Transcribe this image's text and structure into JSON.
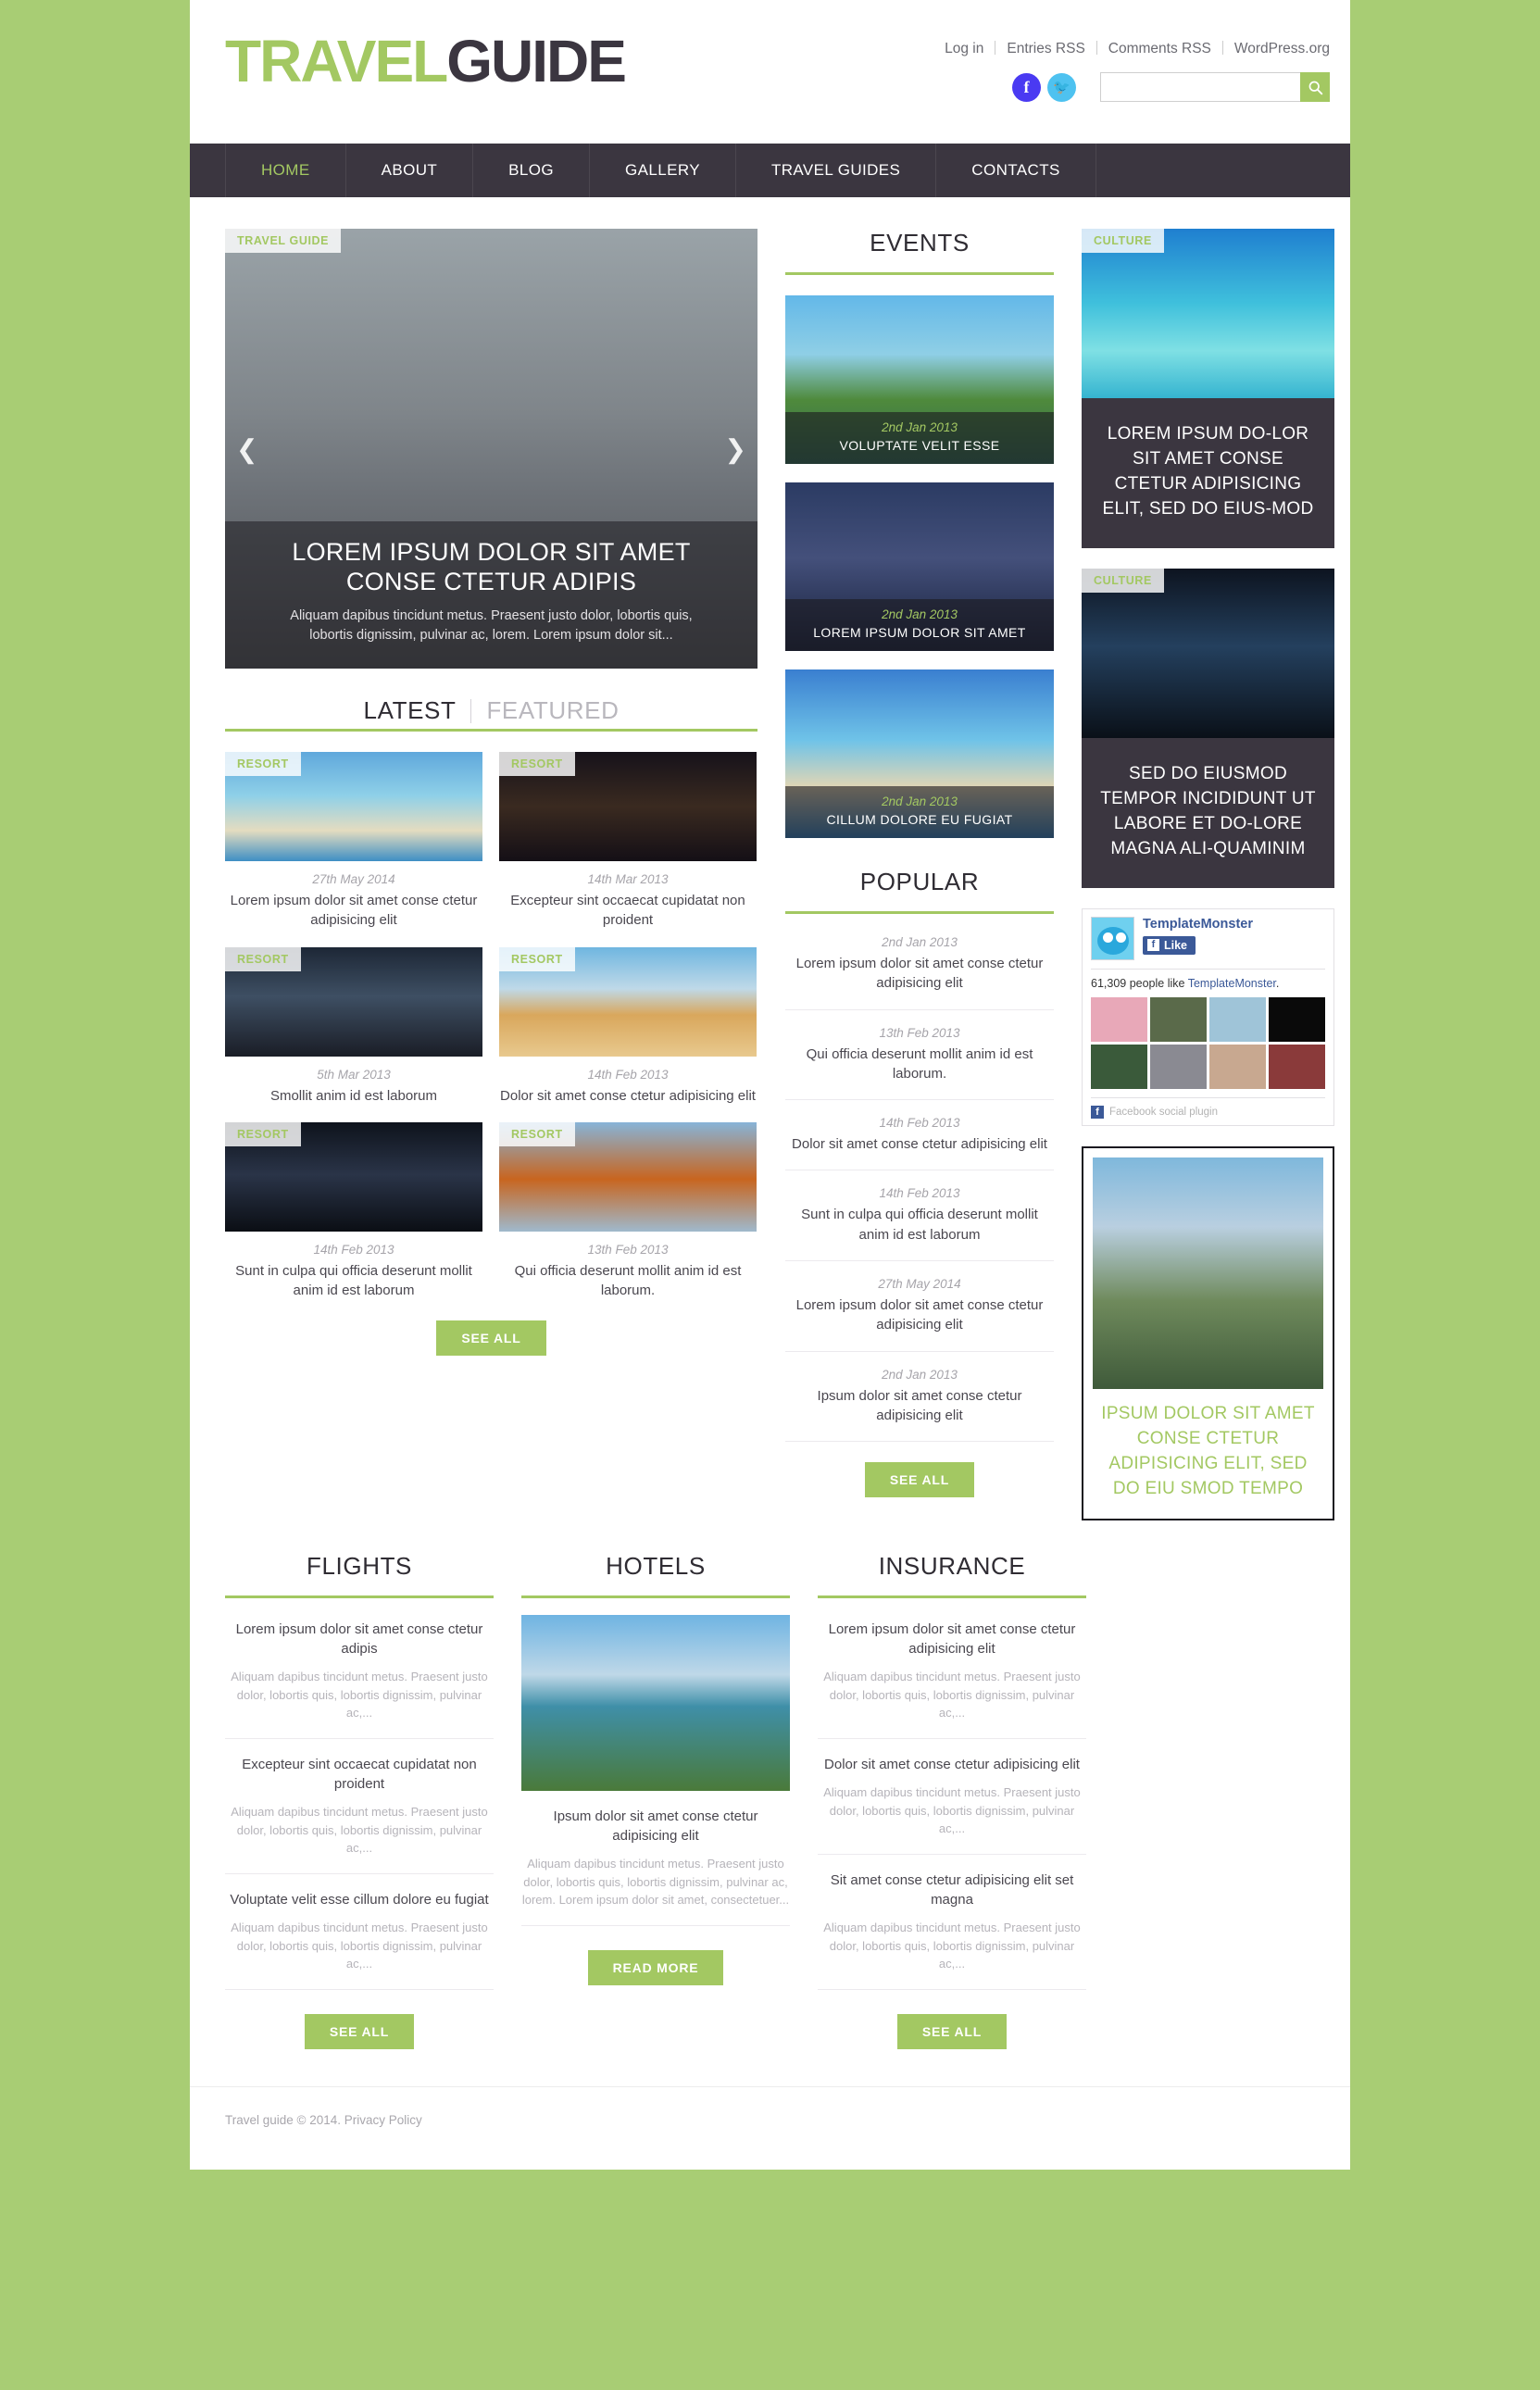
{
  "header": {
    "logo_part1": "TRAVEL",
    "logo_part2": "GUIDE",
    "toplinks": [
      "Log in",
      "Entries RSS",
      "Comments RSS",
      "WordPress.org"
    ],
    "social": [
      "facebook-icon",
      "twitter-icon"
    ],
    "search_placeholder": "",
    "search_value": "",
    "search_icon": "search-icon"
  },
  "nav": {
    "items": [
      {
        "label": "HOME",
        "active": true
      },
      {
        "label": "ABOUT",
        "active": false
      },
      {
        "label": "BLOG",
        "active": false
      },
      {
        "label": "GALLERY",
        "active": false
      },
      {
        "label": "TRAVEL GUIDES",
        "active": false
      },
      {
        "label": "CONTACTS",
        "active": false
      }
    ]
  },
  "slider": {
    "badge": "TRAVEL GUIDE",
    "title": "LOREM IPSUM DOLOR SIT AMET CONSE CTETUR ADIPIS",
    "description": "Aliquam dapibus tincidunt metus. Praesent justo dolor, lobortis quis, lobortis dignissim, pulvinar ac, lorem. Lorem ipsum dolor sit...",
    "prev_icon": "chevron-left-icon",
    "next_icon": "chevron-right-icon"
  },
  "posts_section": {
    "tab_latest": "LATEST",
    "tab_featured": "FEATURED",
    "see_all": "SEE ALL",
    "items": [
      {
        "badge": "RESORT",
        "date": "27th May 2014",
        "title": "Lorem ipsum dolor sit amet conse ctetur adipisicing elit",
        "img": "ph-beachpalm"
      },
      {
        "badge": "RESORT",
        "date": "14th Mar 2013",
        "title": "Excepteur sint occaecat cupidatat non proident",
        "img": "ph-bridge"
      },
      {
        "badge": "RESORT",
        "date": "5th Mar 2013",
        "title": "Smollit anim id est laborum",
        "img": "ph-statue"
      },
      {
        "badge": "RESORT",
        "date": "14th Feb 2013",
        "title": "Dolor sit amet conse ctetur adipisicing elit",
        "img": "ph-pyramid"
      },
      {
        "badge": "RESORT",
        "date": "14th Feb 2013",
        "title": "Sunt in culpa qui officia deserunt mollit anim id est laborum",
        "img": "ph-skyline"
      },
      {
        "badge": "RESORT",
        "date": "13th Feb 2013",
        "title": "Qui officia deserunt mollit anim id est laborum.",
        "img": "ph-kremlin"
      }
    ]
  },
  "events": {
    "title": "EVENTS",
    "items": [
      {
        "date": "2nd Jan 2013",
        "title": "VOLUPTATE VELIT ESSE",
        "img": "ph-temple"
      },
      {
        "date": "2nd Jan 2013",
        "title": "LOREM IPSUM DOLOR SIT AMET",
        "img": "ph-city"
      },
      {
        "date": "2nd Jan 2013",
        "title": "CILLUM DOLORE EU FUGIAT",
        "img": "ph-beach2"
      }
    ]
  },
  "popular": {
    "title": "POPULAR",
    "see_all": "SEE ALL",
    "items": [
      {
        "date": "2nd Jan 2013",
        "title": "Lorem ipsum dolor sit amet conse ctetur adipisicing elit"
      },
      {
        "date": "13th Feb 2013",
        "title": "Qui officia deserunt mollit anim id est laborum."
      },
      {
        "date": "14th Feb 2013",
        "title": "Dolor sit amet conse ctetur adipisicing elit"
      },
      {
        "date": "14th Feb 2013",
        "title": "Sunt in culpa qui officia deserunt mollit anim id est laborum"
      },
      {
        "date": "27th May 2014",
        "title": "Lorem ipsum dolor sit amet conse ctetur adipisicing elit"
      },
      {
        "date": "2nd Jan 2013",
        "title": "Ipsum dolor sit amet conse ctetur adipisicing elit"
      }
    ]
  },
  "culture_cards": [
    {
      "badge": "CULTURE",
      "title": "LOREM IPSUM DO-LOR SIT AMET CONSE CTETUR ADIPISICING ELIT, SED DO EIUS-MOD",
      "img": "ph-overwater"
    },
    {
      "badge": "CULTURE",
      "title": "SED DO EIUSMOD TEMPOR INCIDIDUNT UT LABORE ET DO-LORE MAGNA ALI-QUAMINIM",
      "img": "ph-bridgelight"
    }
  ],
  "facebook": {
    "page_name": "TemplateMonster",
    "like_label": "Like",
    "count_prefix": "61,309 people like ",
    "count_link": "TemplateMonster",
    "count_suffix": ".",
    "plugin_label": "Facebook social plugin",
    "face_colors": [
      "#e8a8b8",
      "#5a6a4a",
      "#9fc4d8",
      "#0a0a0a",
      "#3a5a3a",
      "#8a8a92",
      "#c8a890",
      "#8a3a3a"
    ]
  },
  "ad": {
    "text": "IPSUM DOLOR SIT AMET CONSE CTETUR ADIPISICING ELIT, SED DO EIU SMOD TEMPO",
    "img": "ph-eiffel"
  },
  "bottom": {
    "flights": {
      "title": "FLIGHTS",
      "see_all": "SEE ALL",
      "items": [
        {
          "title": "Lorem ipsum dolor sit amet conse ctetur adipis",
          "text": "Aliquam dapibus tincidunt metus. Praesent justo dolor, lobortis quis, lobortis dignissim, pulvinar ac,..."
        },
        {
          "title": "Excepteur sint occaecat cupidatat non proident",
          "text": "Aliquam dapibus tincidunt metus. Praesent justo dolor, lobortis quis, lobortis dignissim, pulvinar ac,..."
        },
        {
          "title": "Voluptate velit esse cillum dolore eu fugiat",
          "text": "Aliquam dapibus tincidunt metus. Praesent justo dolor, lobortis quis, lobortis dignissim, pulvinar ac,..."
        }
      ]
    },
    "hotels": {
      "title": "HOTELS",
      "read_more": "READ MORE",
      "img": "ph-hotel",
      "item_title": "Ipsum dolor sit amet conse ctetur adipisicing elit",
      "item_text": "Aliquam dapibus tincidunt metus. Praesent justo dolor, lobortis quis, lobortis dignissim, pulvinar ac, lorem. Lorem ipsum dolor sit amet, consectetuer..."
    },
    "insurance": {
      "title": "INSURANCE",
      "see_all": "SEE ALL",
      "items": [
        {
          "title": "Lorem ipsum dolor sit amet conse ctetur adipisicing elit",
          "text": "Aliquam dapibus tincidunt metus. Praesent justo dolor, lobortis quis, lobortis dignissim, pulvinar ac,..."
        },
        {
          "title": "Dolor sit amet conse ctetur adipisicing elit",
          "text": "Aliquam dapibus tincidunt metus. Praesent justo dolor, lobortis quis, lobortis dignissim, pulvinar ac,..."
        },
        {
          "title": "Sit amet conse ctetur adipisicing elit set magna",
          "text": "Aliquam dapibus tincidunt metus. Praesent justo dolor, lobortis quis, lobortis dignissim, pulvinar ac,..."
        }
      ]
    }
  },
  "footer": {
    "copyright": "Travel guide © 2014. ",
    "privacy": "Privacy Policy"
  },
  "colors": {
    "accent_green": "#a3c862",
    "page_green": "#a8cd74",
    "dark": "#3b3640"
  }
}
